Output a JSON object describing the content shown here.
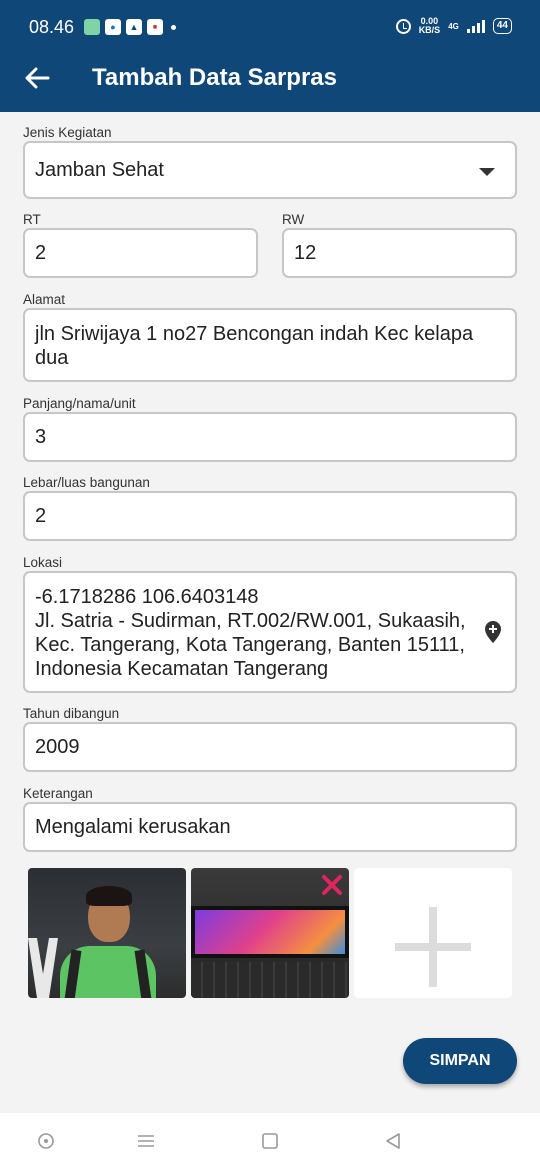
{
  "status_bar": {
    "time": "08.46",
    "net_speed_value": "0.00",
    "net_speed_unit": "KB/S",
    "network_type": "4G",
    "battery": "44"
  },
  "header": {
    "title": "Tambah Data Sarpras"
  },
  "form": {
    "jenis_kegiatan": {
      "label": "Jenis Kegiatan",
      "value": "Jamban Sehat"
    },
    "rt": {
      "label": "RT",
      "value": "2"
    },
    "rw": {
      "label": "RW",
      "value": "12"
    },
    "alamat": {
      "label": "Alamat",
      "value": "jln Sriwijaya 1 no27 Bencongan indah Kec kelapa dua"
    },
    "panjang": {
      "label": "Panjang/nama/unit",
      "value": "3"
    },
    "lebar": {
      "label": "Lebar/luas bangunan",
      "value": "2"
    },
    "lokasi": {
      "label": "Lokasi",
      "value": "-6.1718286 106.6403148\nJl. Satria - Sudirman, RT.002/RW.001, Sukaasih, Kec. Tangerang, Kota Tangerang, Banten 15111, Indonesia Kecamatan Tangerang"
    },
    "tahun": {
      "label": "Tahun dibangun",
      "value": "2009"
    },
    "keterangan": {
      "label": "Keterangan",
      "value": "Mengalami kerusakan"
    }
  },
  "actions": {
    "save_label": "SIMPAN"
  },
  "colors": {
    "primary": "#0f4778",
    "remove": "#e0245e"
  },
  "icons": [
    "back-arrow-icon",
    "dropdown-arrow-icon",
    "location-pin-icon",
    "remove-icon",
    "add-icon",
    "home-icon",
    "menu-icon",
    "recents-icon",
    "back-icon"
  ]
}
